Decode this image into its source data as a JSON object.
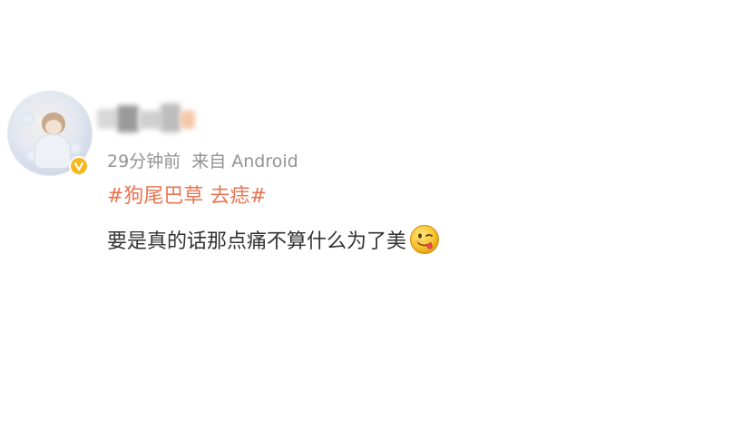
{
  "post": {
    "username_redacted": true,
    "meta": {
      "time": "29分钟前",
      "source": "来自 Android"
    },
    "topic": "#狗尾巴草 去痣#",
    "content": "要是真的话那点痛不算什么为了美",
    "emoji": "tongue-out-emoji"
  },
  "colors": {
    "topic": "#eb7350",
    "meta": "#939393",
    "text": "#333333",
    "badge": "#f6b81d"
  }
}
